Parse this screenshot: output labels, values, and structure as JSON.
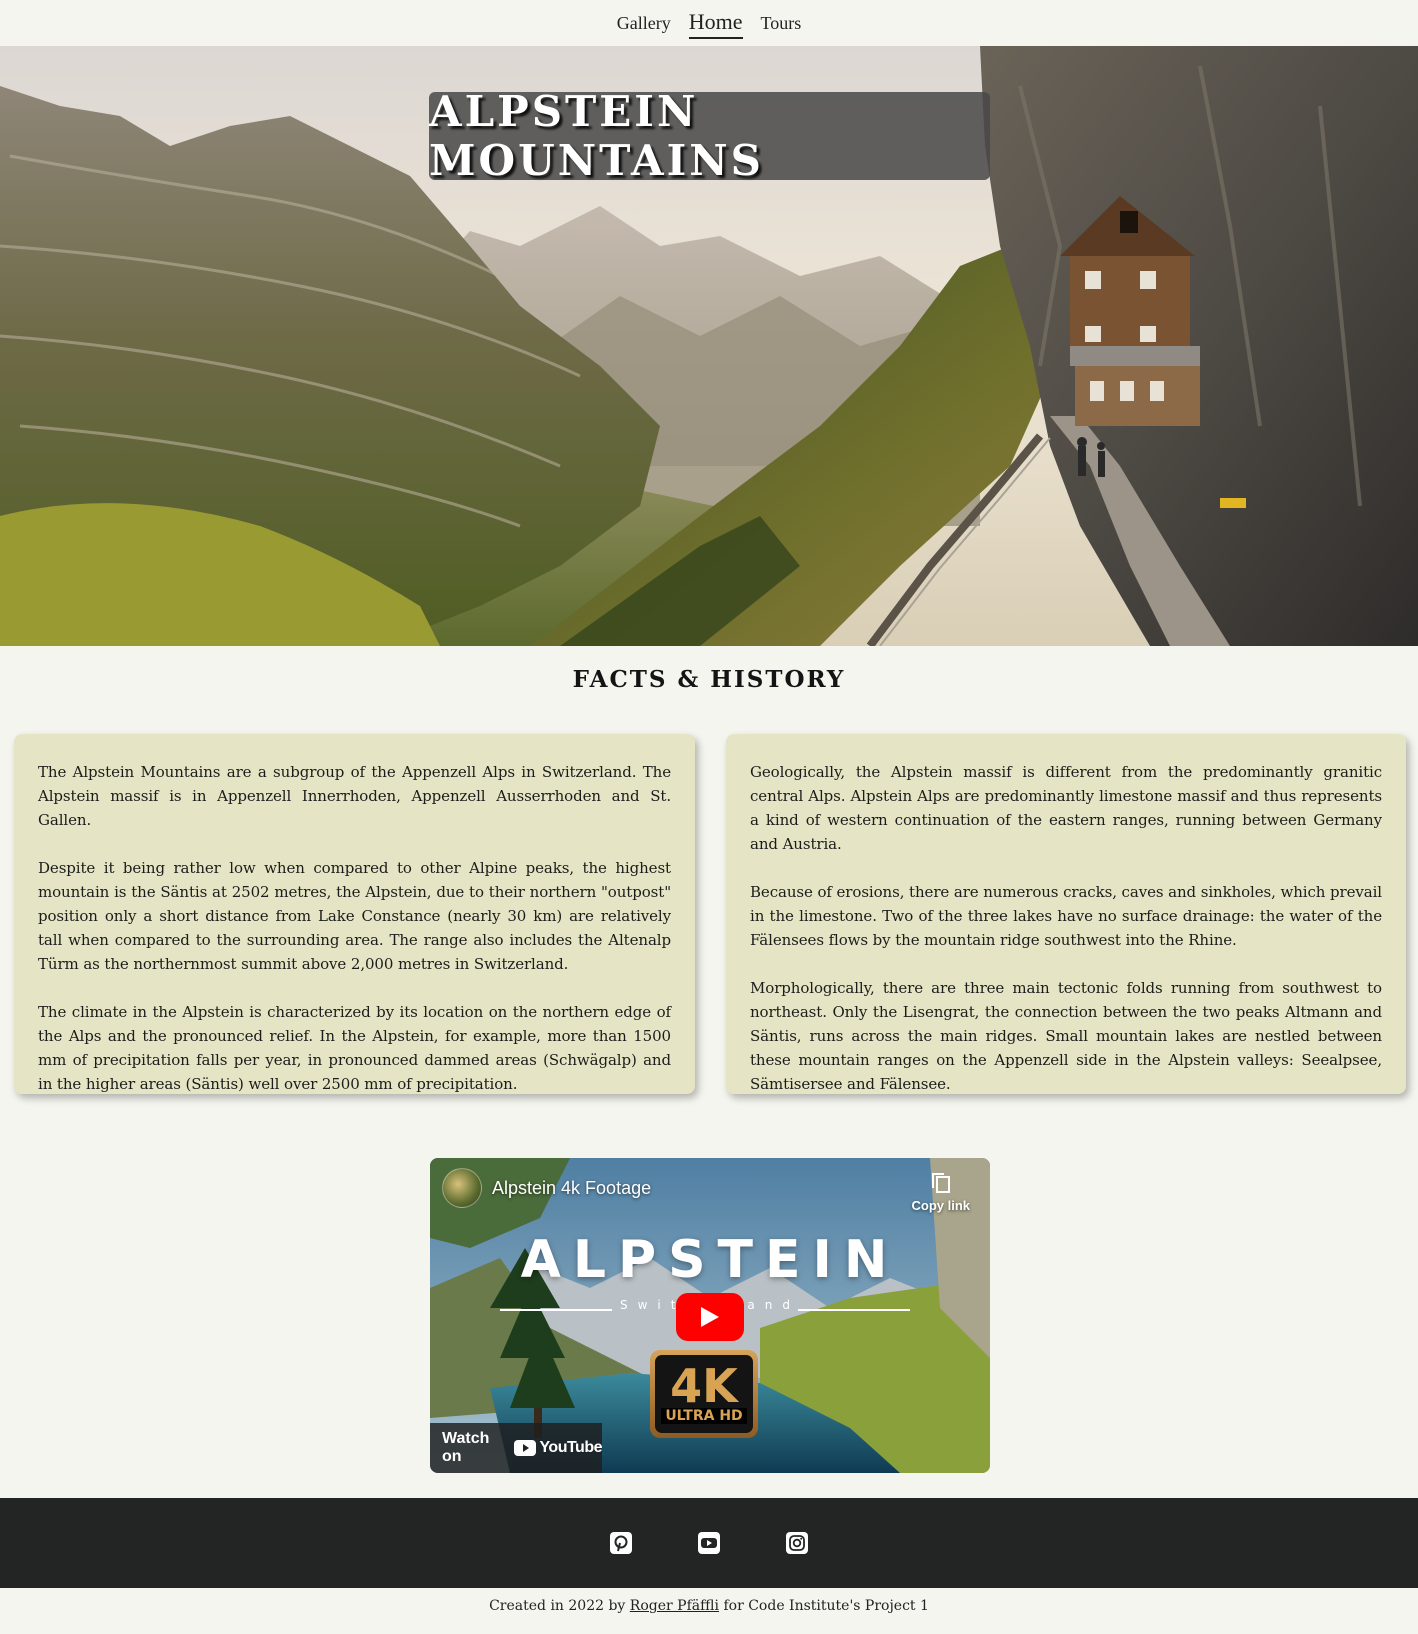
{
  "nav": {
    "items": [
      {
        "label": "Gallery"
      },
      {
        "label": "Home"
      },
      {
        "label": "Tours"
      }
    ],
    "active": "Home"
  },
  "hero": {
    "title": "ALPSTEIN MOUNTAINS"
  },
  "facts": {
    "heading": "FACTS & HISTORY",
    "left": [
      "The Alpstein Mountains are a subgroup of the Appenzell Alps in Switzerland. The Alpstein massif is in Appenzell Innerrhoden, Appenzell Ausserrhoden and St. Gallen.",
      "Despite it being rather low when compared to other Alpine peaks, the highest mountain is the Säntis at 2502 metres, the Alpstein, due to their northern \"outpost\" position only a short distance from Lake Constance (nearly 30 km) are relatively tall when compared to the surrounding area. The range also includes the Altenalp Türm as the northernmost summit above 2,000 metres in Switzerland.",
      "The climate in the Alpstein is characterized by its location on the northern edge of the Alps and the pronounced relief. In the Alpstein, for example, more than 1500 mm of precipitation falls per year, in pronounced dammed areas (Schwägalp) and in the higher areas (Säntis) well over 2500 mm of precipitation."
    ],
    "right": [
      "Geologically, the Alpstein massif is different from the predominantly granitic central Alps. Alpstein Alps are predominantly limestone massif and thus represents a kind of western continuation of the eastern ranges, running between Germany and Austria.",
      "Because of erosions, there are numerous cracks, caves and sinkholes, which prevail in the limestone. Two of the three lakes have no surface drainage: the water of the Fälensees flows by the mountain ridge southwest into the Rhine.",
      "Morphologically, there are three main tectonic folds running from southwest to northeast. Only the Lisengrat, the connection between the two peaks Altmann and Säntis, runs across the main ridges. Small mountain lakes are nestled between these mountain ranges on the Appenzell side in the Alpstein valleys: Seealpsee, Sämtisersee and Fälensee."
    ]
  },
  "video": {
    "title": "Alpstein 4k Footage",
    "copy_link": "Copy link",
    "overlay_title": "ALPSTEIN",
    "overlay_subtitle": "Switzerland",
    "badge_big": "4K",
    "badge_small": "ULTRA HD",
    "watch_on": "Watch on",
    "youtube": "YouTube"
  },
  "footer": {
    "icons": [
      "pinterest-icon",
      "youtube-icon",
      "instagram-icon"
    ],
    "credit_prefix": "Created in 2022 by ",
    "credit_author": "Roger Pfäffli",
    "credit_suffix": " for Code Institute's Project 1"
  },
  "colors": {
    "page_bg": "#f5f5ef",
    "card_bg": "#e5e5c5",
    "footer_bg": "#222524",
    "title_box": "#484848"
  }
}
